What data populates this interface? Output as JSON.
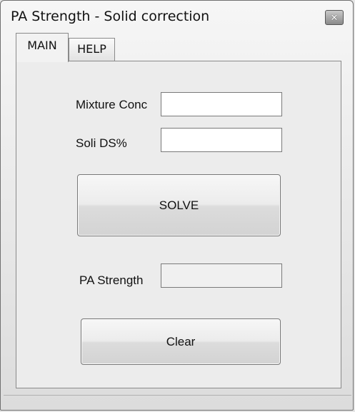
{
  "window": {
    "title": "PA Strength - Solid correction"
  },
  "tabs": [
    {
      "label": "MAIN",
      "selected": true
    },
    {
      "label": "HELP",
      "selected": false
    }
  ],
  "form": {
    "mixture_conc": {
      "label": "Mixture Conc",
      "value": ""
    },
    "soli_ds": {
      "label": "Soli DS%",
      "value": ""
    },
    "solve_label": "SOLVE",
    "pa_strength": {
      "label": "PA Strength",
      "value": ""
    },
    "clear_label": "Clear"
  },
  "icons": {
    "close": "close-icon"
  }
}
